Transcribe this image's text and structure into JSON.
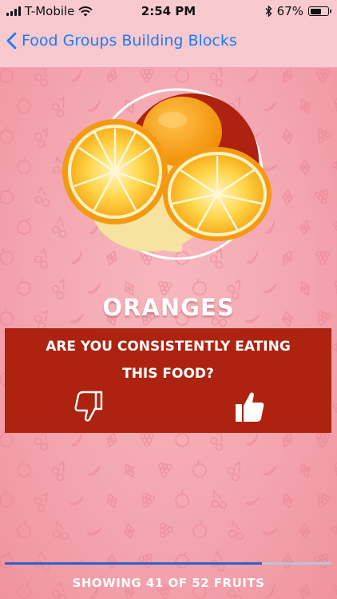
{
  "status_bar": {
    "carrier": "T-Mobile",
    "time": "2:54 PM",
    "battery_percent": "67%",
    "battery_level": 0.67
  },
  "nav": {
    "back_label": "Food Groups Building Blocks"
  },
  "food": {
    "name": "ORANGES"
  },
  "question": {
    "line1": "ARE YOU CONSISTENTLY EATING",
    "line2": "THIS FOOD?"
  },
  "progress": {
    "label": "SHOWING 41 OF 52 FRUITS",
    "current": 41,
    "total": 52
  },
  "colors": {
    "panel": "#ad2310",
    "background": "#f3a3ad",
    "accent_blue": "#1a7cf5",
    "progress_fill": "#2f62c8"
  },
  "icons": [
    "signal-icon",
    "wifi-icon",
    "bluetooth-icon",
    "battery-icon",
    "chevron-left-icon",
    "thumbs-down-icon",
    "thumbs-up-icon"
  ]
}
